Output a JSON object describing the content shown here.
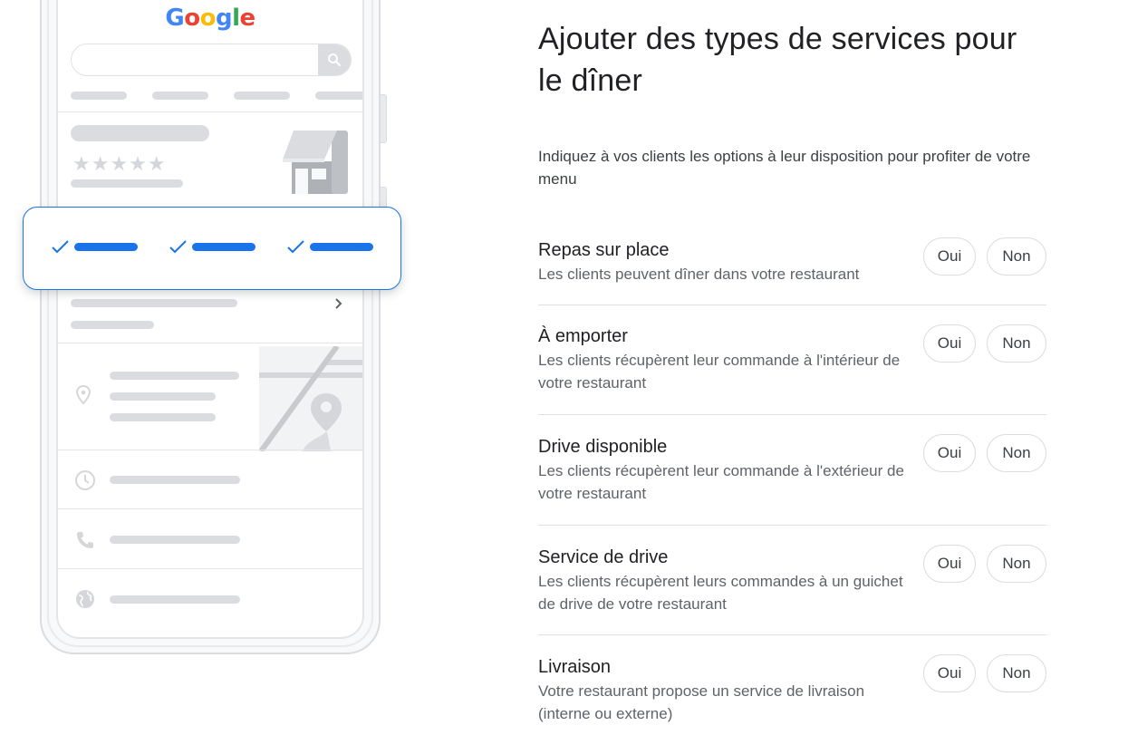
{
  "illustration": {
    "logo_letters": [
      {
        "char": "G",
        "color": "#4285F4"
      },
      {
        "char": "o",
        "color": "#EA4335"
      },
      {
        "char": "o",
        "color": "#FBBC05"
      },
      {
        "char": "g",
        "color": "#4285F4"
      },
      {
        "char": "l",
        "color": "#34A853"
      },
      {
        "char": "e",
        "color": "#EA4335"
      }
    ],
    "rating_stars": "★★★★★",
    "highlight_checks": [
      "✓",
      "✓",
      "✓"
    ],
    "accent_color": "#1a73e8"
  },
  "page": {
    "title": "Ajouter des types de services pour le dîner",
    "description": "Indiquez à vos clients les options à leur disposition pour profiter de votre menu"
  },
  "services": [
    {
      "title": "Repas sur place",
      "description": "Les clients peuvent dîner dans votre restaurant",
      "yes_label": "Oui",
      "no_label": "Non"
    },
    {
      "title": "À emporter",
      "description": "Les clients récupèrent leur commande à l'intérieur de votre restaurant",
      "yes_label": "Oui",
      "no_label": "Non"
    },
    {
      "title": "Drive disponible",
      "description": "Les clients récupèrent leur commande à l'extérieur de votre restaurant",
      "yes_label": "Oui",
      "no_label": "Non"
    },
    {
      "title": "Service de drive",
      "description": "Les clients récupèrent leurs commandes à un guichet de drive de votre restaurant",
      "yes_label": "Oui",
      "no_label": "Non"
    },
    {
      "title": "Livraison",
      "description": "Votre restaurant propose un service de livraison (interne ou externe)",
      "yes_label": "Oui",
      "no_label": "Non"
    }
  ]
}
